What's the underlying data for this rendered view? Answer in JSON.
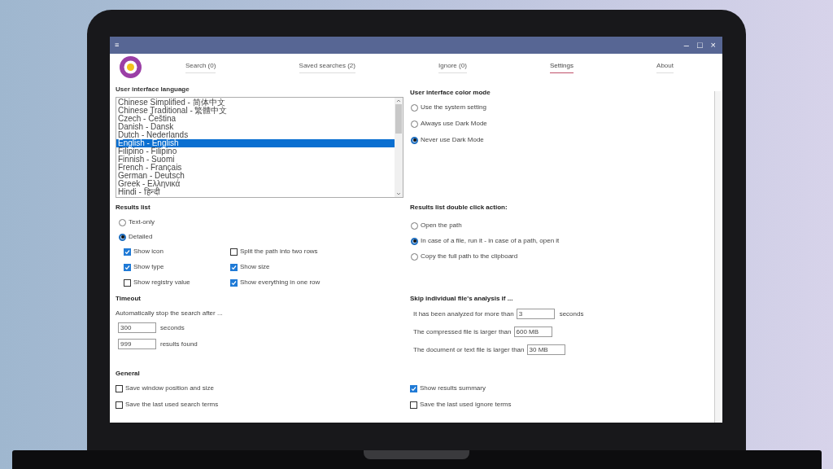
{
  "window": {
    "menu_glyph": "≡",
    "controls": [
      "–",
      "□",
      "×"
    ]
  },
  "tabs": [
    {
      "label": "Search (0)",
      "selected": false
    },
    {
      "label": "Saved searches (2)",
      "selected": false
    },
    {
      "label": "Ignore (0)",
      "selected": false
    },
    {
      "label": "Settings",
      "selected": true
    },
    {
      "label": "About",
      "selected": false
    }
  ],
  "language": {
    "title": "User interface language",
    "items": [
      {
        "label": "Chinese Simplified - 简体中文",
        "selected": false
      },
      {
        "label": "Chinese Traditional - 繁體中文",
        "selected": false
      },
      {
        "label": "Czech - Čeština",
        "selected": false
      },
      {
        "label": "Danish - Dansk",
        "selected": false
      },
      {
        "label": "Dutch - Nederlands",
        "selected": false
      },
      {
        "label": "English - English",
        "selected": true
      },
      {
        "label": "Filipino - Filipino",
        "selected": false
      },
      {
        "label": "Finnish - Suomi",
        "selected": false
      },
      {
        "label": "French - Français",
        "selected": false
      },
      {
        "label": "German - Deutsch",
        "selected": false
      },
      {
        "label": "Greek - Ελληνικά",
        "selected": false
      },
      {
        "label": "Hindi - हिन्दी",
        "selected": false
      }
    ]
  },
  "color_mode": {
    "title": "User interface color mode",
    "options": [
      {
        "label": "Use the system setting",
        "selected": false
      },
      {
        "label": "Always use Dark Mode",
        "selected": false
      },
      {
        "label": "Never use Dark Mode",
        "selected": true
      }
    ]
  },
  "results_list": {
    "title": "Results list",
    "options": [
      {
        "label": "Text-only",
        "selected": false
      },
      {
        "label": "Detailed",
        "selected": true
      }
    ],
    "checkboxes": [
      {
        "label": "Show icon",
        "checked": true
      },
      {
        "label": "Split the path into two rows",
        "checked": false
      },
      {
        "label": "Show type",
        "checked": true
      },
      {
        "label": "Show size",
        "checked": true
      },
      {
        "label": "Show registry value",
        "checked": false
      },
      {
        "label": "Show everything in one row",
        "checked": true
      }
    ]
  },
  "double_click": {
    "title": "Results list double click action:",
    "options": [
      {
        "label": "Open the path",
        "selected": false
      },
      {
        "label": "In case of a file, run it - in case of a path, open it",
        "selected": true
      },
      {
        "label": "Copy the full path to the clipboard",
        "selected": false
      }
    ]
  },
  "timeout": {
    "title": "Timeout",
    "description": "Automatically stop the search after ...",
    "fields": [
      {
        "value": "300",
        "unit": "seconds"
      },
      {
        "value": "999",
        "unit": "results found"
      }
    ]
  },
  "skip": {
    "title": "Skip individual file's analysis if ...",
    "rows": [
      {
        "label": "It has been analyzed for more than",
        "value": "3",
        "unit": "seconds"
      },
      {
        "label": "The compressed file is larger than",
        "value": "600 MB"
      },
      {
        "label": "The document or text file is larger than",
        "value": "30 MB"
      }
    ]
  },
  "general": {
    "title": "General",
    "checkboxes": [
      {
        "label": "Save window position and size",
        "checked": false
      },
      {
        "label": "Show results summary",
        "checked": true
      },
      {
        "label": "Save the last used search terms",
        "checked": false
      },
      {
        "label": "Save the last used ignore terms",
        "checked": false
      }
    ]
  }
}
